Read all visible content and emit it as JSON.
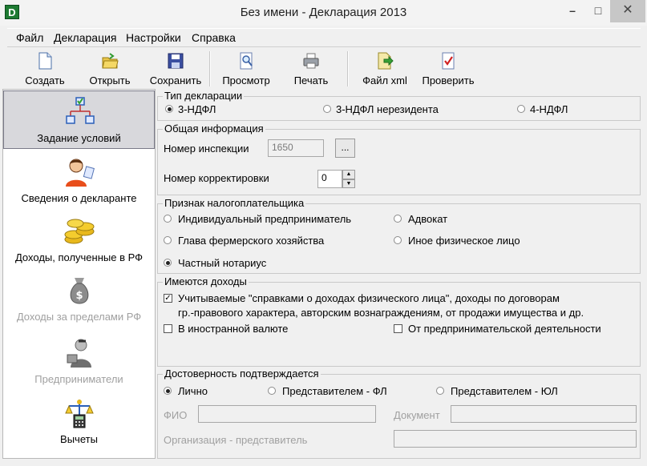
{
  "window": {
    "title": "Без имени - Декларация 2013",
    "app_icon": "D",
    "minimize": "–",
    "maximize": "□",
    "close": "✕"
  },
  "menu": [
    "Файл",
    "Декларация",
    "Настройки",
    "Справка"
  ],
  "toolbar": [
    {
      "label": "Создать",
      "icon": "new-document-icon"
    },
    {
      "label": "Открыть",
      "icon": "open-folder-icon"
    },
    {
      "label": "Сохранить",
      "icon": "save-disk-icon"
    },
    {
      "label": "Просмотр",
      "icon": "preview-icon"
    },
    {
      "label": "Печать",
      "icon": "printer-icon"
    },
    {
      "label": "Файл xml",
      "icon": "xml-file-icon"
    },
    {
      "label": "Проверить",
      "icon": "check-document-icon"
    }
  ],
  "nav": [
    {
      "label": "Задание условий",
      "selected": true,
      "enabled": true
    },
    {
      "label": "Сведения о декларанте",
      "selected": false,
      "enabled": true
    },
    {
      "label": "Доходы, полученные в РФ",
      "selected": false,
      "enabled": true
    },
    {
      "label": "Доходы за пределами РФ",
      "selected": false,
      "enabled": false
    },
    {
      "label": "Предприниматели",
      "selected": false,
      "enabled": false
    },
    {
      "label": "Вычеты",
      "selected": false,
      "enabled": true
    }
  ],
  "declaration_type": {
    "legend": "Тип декларации",
    "options": [
      "3-НДФЛ",
      "3-НДФЛ нерезидента",
      "4-НДФЛ"
    ],
    "selected": "3-НДФЛ"
  },
  "general": {
    "legend": "Общая информация",
    "inspection_label": "Номер инспекции",
    "inspection_value": "1650",
    "browse_label": "...",
    "correction_label": "Номер корректировки",
    "correction_value": "0"
  },
  "taxpayer": {
    "legend": "Признак налогоплательщика",
    "options": [
      "Индивидуальный предприниматель",
      "Адвокат",
      "Глава фермерского хозяйства",
      "Иное физическое лицо",
      "Частный нотариус"
    ],
    "selected": "Частный нотариус"
  },
  "income": {
    "legend": "Имеются доходы",
    "certified_line1": "Учитываемые \"справками о доходах физического лица\", доходы по договорам",
    "certified_line2": "гр.-правового характера, авторским вознаграждениям, от продажи имущества и др.",
    "certified_checked": true,
    "foreign_currency": "В иностранной валюте",
    "foreign_currency_checked": false,
    "business": "От предпринимательской деятельности",
    "business_checked": false
  },
  "confirmation": {
    "legend": "Достоверность подтверждается",
    "options": [
      "Лично",
      "Представителем - ФЛ",
      "Представителем - ЮЛ"
    ],
    "selected": "Лично",
    "fio_label": "ФИО",
    "document_label": "Документ",
    "org_label": "Организация - представитель"
  },
  "colors": {
    "selected_nav_bg": "#d8d8dc",
    "window_bg": "#f0f0f0",
    "close_btn_bg": "#c7c7c7"
  }
}
